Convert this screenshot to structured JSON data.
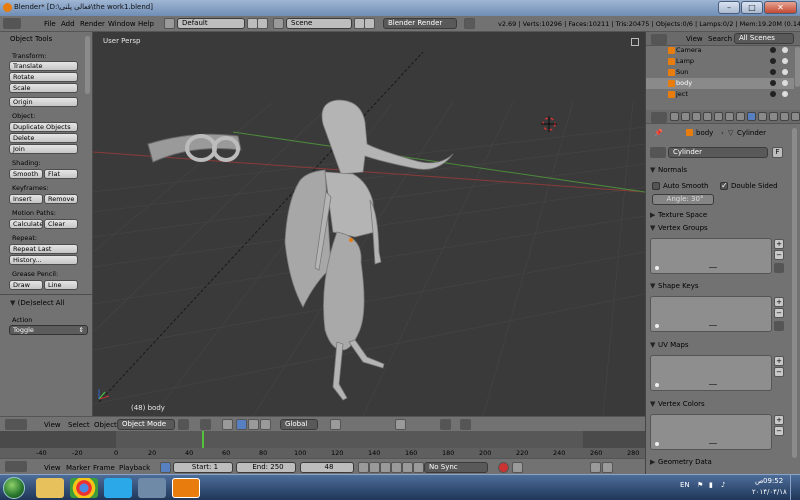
{
  "titlebar": {
    "title": "Blender* [D:\\فعالی پلنی\\the work1.blend]",
    "minimize": "–",
    "maximize": "□",
    "close": "✕"
  },
  "header": {
    "menus": [
      "File",
      "Add",
      "Render",
      "Window",
      "Help"
    ],
    "layout": "Default",
    "scene": "Scene",
    "engine": "Blender Render",
    "stats": "v2.69 | Verts:10296 | Faces:10211 | Tris:20475 | Objects:0/6 | Lamps:0/2 | Mem:19.20M (0.14M) | body"
  },
  "toolshelf": {
    "title": "Object Tools",
    "sections": {
      "transform": "Transform:",
      "object": "Object:",
      "shading": "Shading:",
      "keyframes": "Keyframes:",
      "motion_paths": "Motion Paths:",
      "repeat": "Repeat:",
      "grease_pencil": "Grease Pencil:"
    },
    "buttons": {
      "translate": "Translate",
      "rotate": "Rotate",
      "scale": "Scale",
      "origin": "Origin",
      "duplicate": "Duplicate Objects",
      "delete": "Delete",
      "join": "Join",
      "smooth": "Smooth",
      "flat": "Flat",
      "insert": "Insert",
      "remove": "Remove",
      "calculate": "Calculate",
      "clear": "Clear",
      "repeat_last": "Repeat Last",
      "history": "History...",
      "draw": "Draw",
      "line": "Line"
    },
    "operator_title": "(De)select All",
    "action_label": "Action",
    "action_value": "Toggle"
  },
  "viewport": {
    "label": "User Persp",
    "object_label": "(48) body"
  },
  "viewport_header": {
    "menus": [
      "View",
      "Select",
      "Object"
    ],
    "mode": "Object Mode",
    "orientation": "Global"
  },
  "timeline": {
    "ticks": [
      "-40",
      "-20",
      "0",
      "20",
      "40",
      "60",
      "80",
      "100",
      "120",
      "140",
      "160",
      "180",
      "200",
      "220",
      "240",
      "260",
      "280"
    ],
    "current_frame_fraction": 0.43,
    "menus": [
      "View",
      "Marker",
      "Frame",
      "Playback"
    ],
    "start": "Start: 1",
    "end": "End: 250",
    "frame": "48",
    "sync": "No Sync"
  },
  "outliner": {
    "menus": [
      "View",
      "Search"
    ],
    "filter": "All Scenes",
    "items": [
      "Camera",
      "Lamp",
      "Sun",
      "body",
      "ject"
    ]
  },
  "properties": {
    "breadcrumb_object": "body",
    "breadcrumb_data": "Cylinder",
    "datablock": "Cylinder",
    "fake_user": "F",
    "panels": {
      "normals": "Normals",
      "auto_smooth": "Auto Smooth",
      "double_sided": "Double Sided",
      "angle": "Angle: 30°",
      "texture_space": "Texture Space",
      "vertex_groups": "Vertex Groups",
      "shape_keys": "Shape Keys",
      "uv_maps": "UV Maps",
      "vertex_colors": "Vertex Colors",
      "geometry_data": "Geometry Data"
    },
    "plus": "+",
    "minus": "−"
  },
  "taskbar": {
    "lang": "EN",
    "time": "09:52",
    "ampm": "ص",
    "date": "۲۰۱۴/۰۴/۱۸"
  },
  "colors": {
    "accent_orange": "#e87d0d",
    "grid_red_axis": "#8a3a3a",
    "grid_green_axis": "#4c8a3c",
    "timeline_frame": "#56c23a"
  }
}
